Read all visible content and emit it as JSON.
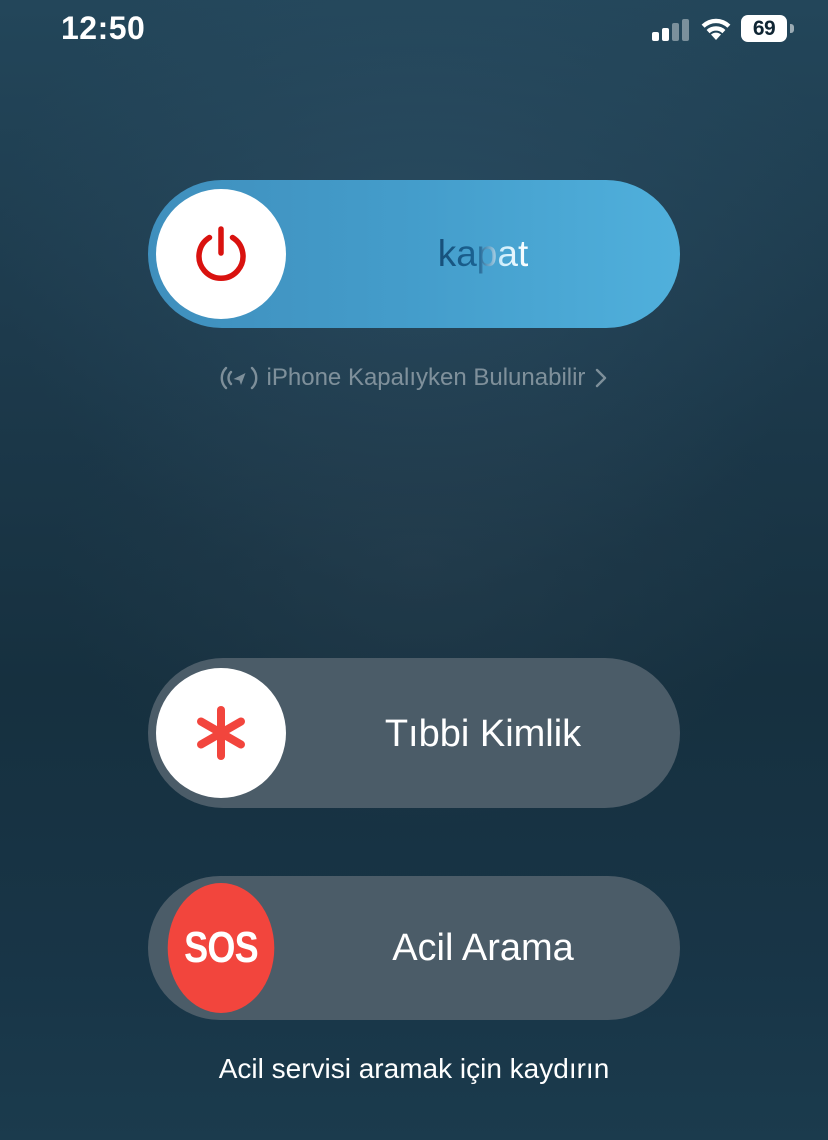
{
  "status_bar": {
    "time": "12:50",
    "battery_level": "69",
    "icons": [
      "cellular-signal-icon",
      "wifi-icon",
      "battery-icon"
    ]
  },
  "power_slider": {
    "label": "kapat",
    "icon": "power-icon",
    "accent_color": "#d9120f"
  },
  "find_my": {
    "text": "iPhone Kapalıyken Bulunabilir",
    "icon": "find-my-broadcast-icon",
    "chevron": "chevron-right-icon"
  },
  "medical_id_slider": {
    "label": "Tıbbi Kimlik",
    "icon": "medical-asterisk-icon",
    "accent_color": "#f2453d"
  },
  "emergency_slider": {
    "label": "Acil Arama",
    "knob_text": "SOS",
    "accent_color": "#f2453d"
  },
  "emergency_hint": "Acil servisi aramak için kaydırın"
}
